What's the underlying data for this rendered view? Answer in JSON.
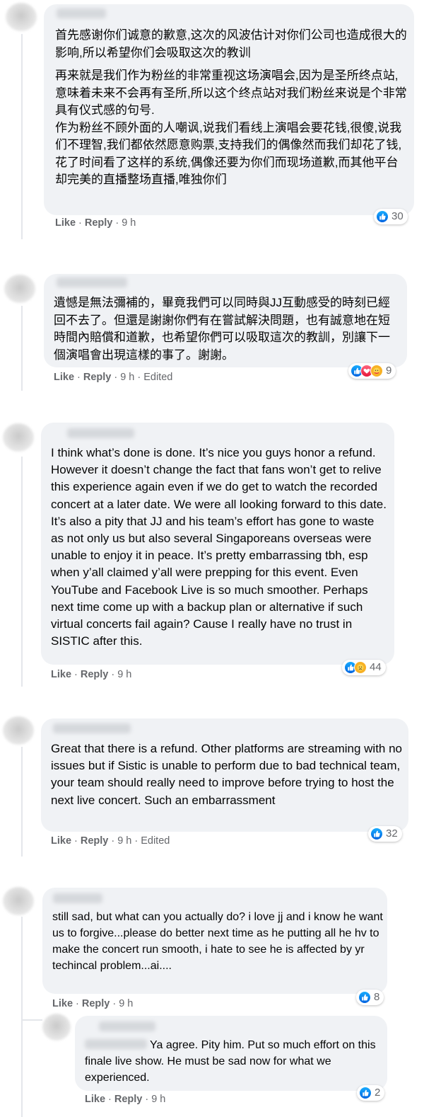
{
  "comments": [
    {
      "paragraphs": [
        "首先感谢你们诚意的歉意,这次的风波估计对你们公司也造成很大的影响,所以希望你们会吸取这次的教训",
        "再来就是我们作为粉丝的非常重视这场演唱会,因为是圣所终点站,意味着未来不会再有圣所,所以这个终点站对我们粉丝来说是个非常具有仪式感的句号.\n作为粉丝不顾外面的人嘲讽,说我们看线上演唱会要花钱,很傻,说我们不理智,我们都依然愿意购票,支持我们的偶像然而我们却花了钱,花了时间看了这样的系统,偶像还要为你们而现场道歉,而其他平台却完美的直播整场直播,唯独你们"
      ],
      "like": "Like",
      "reply": "Reply",
      "time": "9 h",
      "edited": "",
      "reactions": [
        "like"
      ],
      "count": "30"
    },
    {
      "paragraphs": [
        "遺憾是無法彌補的，畢竟我們可以同時與JJ互動感受的時刻已經回不去了。但還是謝謝你們有在嘗試解決問題，也有誠意地在短時間內賠償和道歉，也希望你們可以吸取這次的教訓，別讓下一個演唱會出現這樣的事了。謝謝。"
      ],
      "like": "Like",
      "reply": "Reply",
      "time": "9 h",
      "edited": "Edited",
      "reactions": [
        "like",
        "love",
        "care"
      ],
      "count": "9"
    },
    {
      "paragraphs": [
        "I think what’s done is done. It’s nice you guys honor a refund. However it doesn’t change the fact that fans won’t get to relive this experience again even if we do get to watch the recorded concert at a later date. We were all looking forward to this date. It’s also a pity that JJ and his team’s effort has gone to waste as not only us but also several Singaporeans overseas were unable to enjoy it in peace. It’s pretty embarrassing tbh, esp when y’all claimed y’all were prepping for this event. Even YouTube and Facebook Live is so much smoother. Perhaps next time come up with a backup plan or alternative if such virtual concerts fail again? Cause I really have no trust in SISTIC after this."
      ],
      "like": "Like",
      "reply": "Reply",
      "time": "9 h",
      "edited": "",
      "reactions": [
        "like",
        "sad"
      ],
      "count": "44"
    },
    {
      "paragraphs": [
        "Great that there is a refund. Other platforms are streaming with no issues but if Sistic is unable to perform due to bad technical team, your team should really need to improve before trying to host the next live concert. Such an embarrassment"
      ],
      "like": "Like",
      "reply": "Reply",
      "time": "9 h",
      "edited": "Edited",
      "reactions": [
        "like"
      ],
      "count": "32"
    },
    {
      "paragraphs": [
        "still sad, but what can you actually do? i love jj and i know he want us to forgive...please do better next time as he putting all he hv to make the concert run smooth, i hate to see he is affected by yr techincal problem...ai...."
      ],
      "like": "Like",
      "reply": "Reply",
      "time": "9 h",
      "edited": "",
      "reactions": [
        "like"
      ],
      "count": "8"
    },
    {
      "paragraphs": [
        "Ya agree. Pity him. Put so much effort on this finale live show. He must be sad now for what we experienced."
      ],
      "like": "Like",
      "reply": "Reply",
      "time": "9 h",
      "edited": "",
      "reactions": [
        "like"
      ],
      "count": "2"
    }
  ],
  "colors": {
    "bubble": "#f0f2f5",
    "meta": "#65676b",
    "like": "#1877f2",
    "love": "#f33e58",
    "care": "#f7b125"
  }
}
